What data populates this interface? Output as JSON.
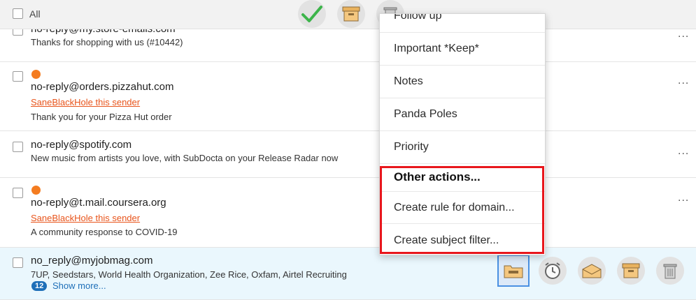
{
  "toolbar": {
    "all_label": "All",
    "icons": [
      "check-icon",
      "archive-box-icon",
      "trash-icon"
    ]
  },
  "emails": [
    {
      "sender": "no-reply@my.store-emails.com",
      "subject": "Thanks for shopping with us (#10442)",
      "unread": false
    },
    {
      "sender": "no-reply@orders.pizzahut.com",
      "blackhole_link": "SaneBlackHole this sender",
      "subject": "Thank you for your Pizza Hut order",
      "unread": true
    },
    {
      "sender": "no-reply@spotify.com",
      "subject": "New music from artists you love, with SubDocta on your Release Radar now",
      "unread": false
    },
    {
      "sender": "no-reply@t.mail.coursera.org",
      "blackhole_link": "SaneBlackHole this sender",
      "subject": "A community response to COVID-19",
      "unread": true
    },
    {
      "sender": "no_reply@myjobmag.com",
      "subject": "7UP, Seedstars, World Health Organization, Zee Rice, Oxfam, Airtel Recruiting",
      "count_badge": "12",
      "show_more": "Show more..."
    }
  ],
  "more_menu_label": "...",
  "row_actions": [
    "folder-move-icon",
    "snooze-clock-icon",
    "open-envelope-icon",
    "archive-box-icon",
    "trash-icon"
  ],
  "dropdown": {
    "items": [
      "Follow up",
      "Important *Keep*",
      "Notes",
      "Panda Poles",
      "Priority"
    ],
    "other_header": "Other actions...",
    "other_items": [
      "Create rule for domain...",
      "Create subject filter..."
    ]
  },
  "colors": {
    "highlight_border": "#e8161c",
    "unread_dot": "#f47c20",
    "link_orange": "#e8541b",
    "badge_blue": "#1e6fb8",
    "selected_row": "#eaf7fd",
    "check_green": "#3cb44a",
    "box_tan": "#f4c77f"
  }
}
